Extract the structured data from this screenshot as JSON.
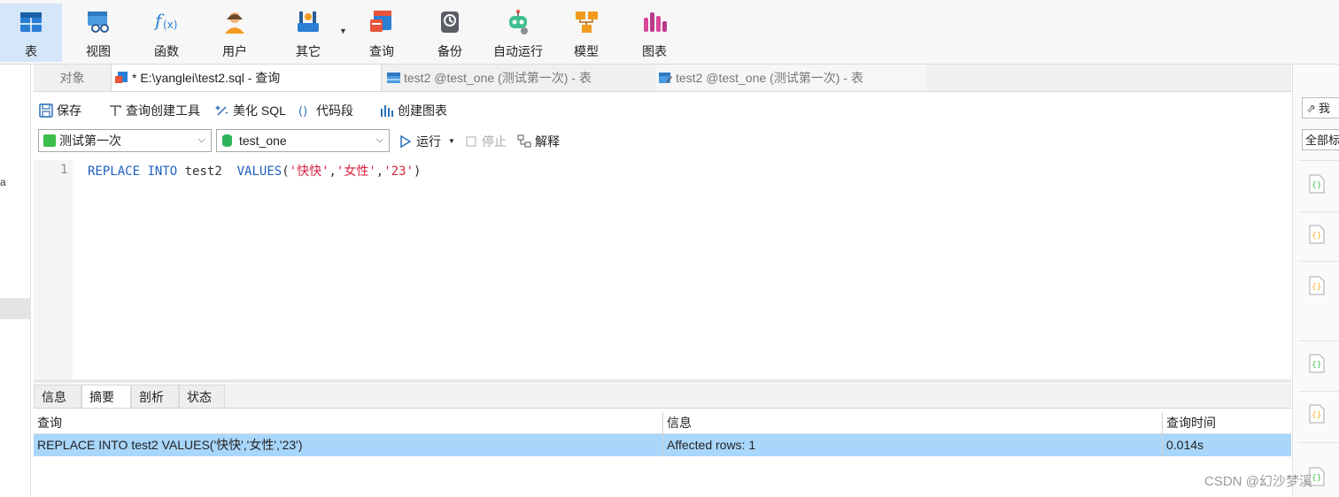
{
  "toolbar": {
    "items": [
      {
        "label": "表",
        "icon": "table-icon"
      },
      {
        "label": "视图",
        "icon": "view-icon"
      },
      {
        "label": "函数",
        "icon": "function-icon"
      },
      {
        "label": "用户",
        "icon": "user-icon"
      },
      {
        "label": "其它",
        "icon": "other-tools-icon"
      },
      {
        "label": "查询",
        "icon": "query-icon"
      },
      {
        "label": "备份",
        "icon": "backup-icon"
      },
      {
        "label": "自动运行",
        "icon": "robot-icon"
      },
      {
        "label": "模型",
        "icon": "model-icon"
      },
      {
        "label": "图表",
        "icon": "chart-icon"
      }
    ]
  },
  "tabs": {
    "objects": "对象",
    "query_tab": "* E:\\yanglei\\test2.sql - 查询",
    "table_tab_1": "test2 @test_one (测试第一次) - 表",
    "table_tab_2": "test2 @test_one (测试第一次) - 表"
  },
  "editor_toolbar": {
    "save": "保存",
    "query_builder": "查询创建工具",
    "beautify": "美化 SQL",
    "snippet": "代码段",
    "create_chart": "创建图表"
  },
  "connection": {
    "connection_name": "测试第一次",
    "database": "test_one",
    "run": "运行",
    "stop": "停止",
    "explain": "解释"
  },
  "editor": {
    "line_number": "1",
    "tokens": {
      "kw1": "REPLACE",
      "kw2": "INTO",
      "table": "test2",
      "kw3": "VALUES",
      "open": "(",
      "s1": "'快快'",
      "c1": ",",
      "s2": "'女性'",
      "c2": ",",
      "s3": "'23'",
      "close": ")"
    }
  },
  "result_tabs": [
    "信息",
    "摘要",
    "剖析",
    "状态"
  ],
  "results": {
    "columns": [
      "查询",
      "信息",
      "查询时间"
    ],
    "row": [
      "REPLACE INTO test2  VALUES('快快','女性','23')",
      "Affected rows: 1",
      "0.014s"
    ]
  },
  "right_sidebar": {
    "btn1": "我",
    "btn2": "全部标"
  },
  "left_sidebar": {
    "fragment": "a"
  },
  "watermark": "CSDN @幻沙梦溪",
  "colors": {
    "accent": "#1f5fbf",
    "string": "#d8223e",
    "selected_row": "#a9d6fb",
    "active_toolbar": "#d4e6f8"
  }
}
